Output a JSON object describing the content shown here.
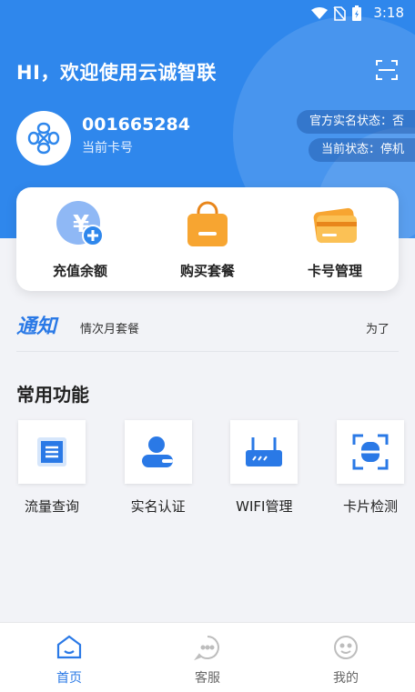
{
  "status_bar": {
    "time": "3:18"
  },
  "header": {
    "welcome": "HI，欢迎使用云诚智联",
    "card_number": "001665284",
    "card_label": "当前卡号",
    "realname_status": "官方实名状态：否",
    "current_state": "当前状态：停机"
  },
  "actions": [
    {
      "label": "充值余额",
      "icon": "recharge-icon"
    },
    {
      "label": "购买套餐",
      "icon": "shopping-bag-icon"
    },
    {
      "label": "卡号管理",
      "icon": "card-icon"
    }
  ],
  "notice": {
    "tag": "通知",
    "text": "情次月套餐",
    "text_right": "为了"
  },
  "common": {
    "title": "常用功能",
    "items": [
      {
        "label": "流量查询",
        "icon": "data-query-icon"
      },
      {
        "label": "实名认证",
        "icon": "id-verify-icon"
      },
      {
        "label": "WIFI管理",
        "icon": "router-icon"
      },
      {
        "label": "卡片检测",
        "icon": "scan-card-icon"
      }
    ]
  },
  "tabbar": [
    {
      "label": "首页",
      "icon": "home-icon",
      "active": true
    },
    {
      "label": "客服",
      "icon": "chat-icon",
      "active": false
    },
    {
      "label": "我的",
      "icon": "profile-icon",
      "active": false
    }
  ],
  "colors": {
    "primary": "#2f87ec",
    "accent": "#2a79e6",
    "orange": "#f7a531"
  }
}
